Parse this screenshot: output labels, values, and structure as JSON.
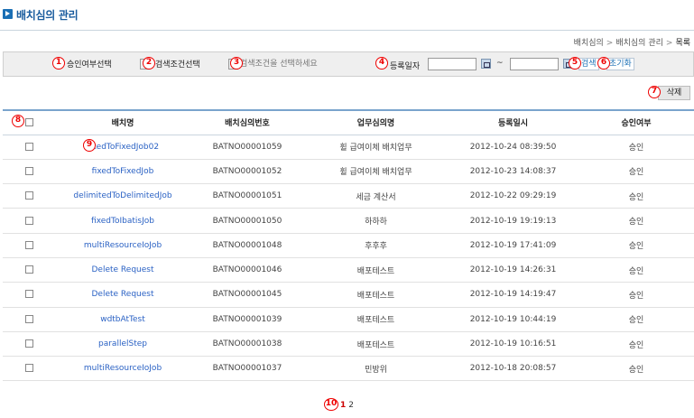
{
  "page": {
    "title": "배치심의 관리",
    "breadcrumb": [
      "배치심의",
      "배치심의 관리",
      "목록"
    ]
  },
  "search": {
    "approval_select": "승인여부선택",
    "condition_select": "검색조건선택",
    "keyword_placeholder": "검색조건을 선택하세요",
    "regdate_label": "등록일자",
    "date_separator": "~",
    "search_button": "검색",
    "reset_button": "초기화"
  },
  "actions": {
    "delete_button": "삭제"
  },
  "table": {
    "columns": [
      "배치명",
      "배치심의번호",
      "업무심의명",
      "등록일시",
      "승인여부"
    ],
    "rows": [
      {
        "name": "fixedToFixedJob02",
        "review_no": "BATNO00001059",
        "task": "휠 급여이체 배치업무",
        "datetime": "2012-10-24 08:39:50",
        "status": "승인"
      },
      {
        "name": "fixedToFixedJob",
        "review_no": "BATNO00001052",
        "task": "휠 급여이체 배치업무",
        "datetime": "2012-10-23 14:08:37",
        "status": "승인"
      },
      {
        "name": "delimitedToDelimitedJob",
        "review_no": "BATNO00001051",
        "task": "세금 계산서",
        "datetime": "2012-10-22 09:29:19",
        "status": "승인"
      },
      {
        "name": "fixedToIbatisJob",
        "review_no": "BATNO00001050",
        "task": "하하하",
        "datetime": "2012-10-19 19:19:13",
        "status": "승인"
      },
      {
        "name": "multiResourceIoJob",
        "review_no": "BATNO00001048",
        "task": "후후후",
        "datetime": "2012-10-19 17:41:09",
        "status": "승인"
      },
      {
        "name": "Delete Request",
        "review_no": "BATNO00001046",
        "task": "배포테스트",
        "datetime": "2012-10-19 14:26:31",
        "status": "승인"
      },
      {
        "name": "Delete Request",
        "review_no": "BATNO00001045",
        "task": "배포테스트",
        "datetime": "2012-10-19 14:19:47",
        "status": "승인"
      },
      {
        "name": "wdtbAtTest",
        "review_no": "BATNO00001039",
        "task": "배포테스트",
        "datetime": "2012-10-19 10:44:19",
        "status": "승인"
      },
      {
        "name": "parallelStep",
        "review_no": "BATNO00001038",
        "task": "배포테스트",
        "datetime": "2012-10-19 10:16:51",
        "status": "승인"
      },
      {
        "name": "multiResourceIoJob",
        "review_no": "BATNO00001037",
        "task": "민방위",
        "datetime": "2012-10-18 20:08:57",
        "status": "승인"
      }
    ]
  },
  "pagination": {
    "current": "1",
    "pages": [
      "2"
    ]
  },
  "annotations": [
    "1",
    "2",
    "3",
    "4",
    "5",
    "6",
    "7",
    "8",
    "9",
    "10"
  ]
}
